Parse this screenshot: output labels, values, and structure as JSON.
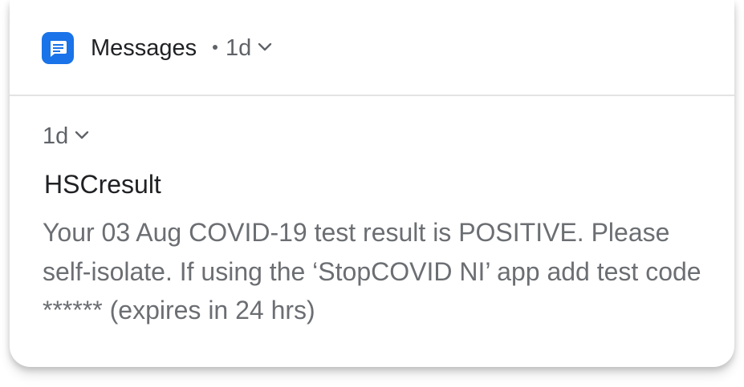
{
  "notification": {
    "app_name": "Messages",
    "app_icon": "messages-chat-bubble-icon",
    "accent_color": "#1a73e8",
    "header_time": "1d",
    "message": {
      "time": "1d",
      "sender": "HSCresult",
      "body": "Your 03 Aug COVID-19 test result is POSITIVE. Please self-isolate. If using the ‘StopCOVID NI’ app add test code ****** (expires in 24 hrs)"
    }
  }
}
